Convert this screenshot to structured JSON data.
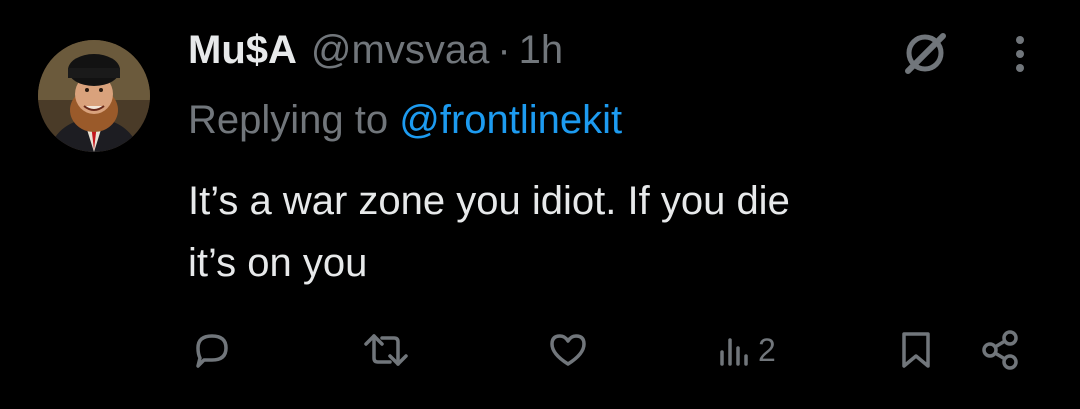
{
  "author": {
    "display_name": "Mu$A",
    "handle": "@mvsvaa",
    "separator": "·",
    "time": "1h"
  },
  "reply": {
    "prefix": "Replying to",
    "mention": "@frontlinekit"
  },
  "tweet": {
    "line1": "It’s a war zone you idiot. If you die",
    "line2": "it’s on you"
  },
  "actions": {
    "views": "2",
    "icons": [
      "reply-icon",
      "retweet-icon",
      "like-icon",
      "views-icon",
      "bookmark-icon",
      "share-icon"
    ]
  },
  "colors": {
    "background": "#000000",
    "text": "#e7e9ea",
    "muted": "#71767b",
    "link": "#1d9bf0"
  }
}
